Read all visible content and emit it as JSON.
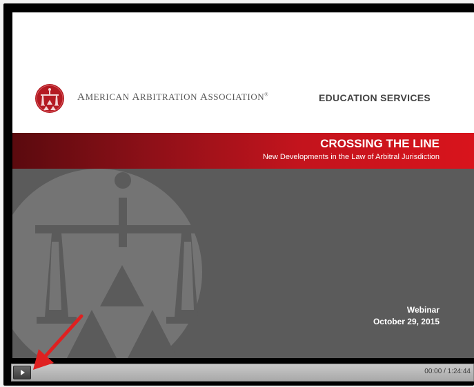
{
  "slide": {
    "organization": {
      "name_parts": [
        "A",
        "MERICAN ",
        "A",
        "RBITRATION ",
        "A",
        "SSOCIATION",
        "®"
      ]
    },
    "division": "EDUCATION SERVICES",
    "title": "CROSSING THE LINE",
    "subtitle": "New Developments in the Law of Arbitral Jurisdiction",
    "event_type": "Webinar",
    "event_date": "October  29, 2015"
  },
  "player": {
    "time_display": "00:00 / 1:24:44",
    "progress": 0
  },
  "colors": {
    "banner_red": "#c3141d",
    "banner_dark": "#5a0a0e",
    "slide_body_gray": "#5b5b5b",
    "logo_red": "#b41a22",
    "annotation_arrow": "#e02020"
  },
  "icons": {
    "logo": "scales-of-justice-icon",
    "play": "play-icon",
    "annotation": "red-arrow-icon"
  }
}
